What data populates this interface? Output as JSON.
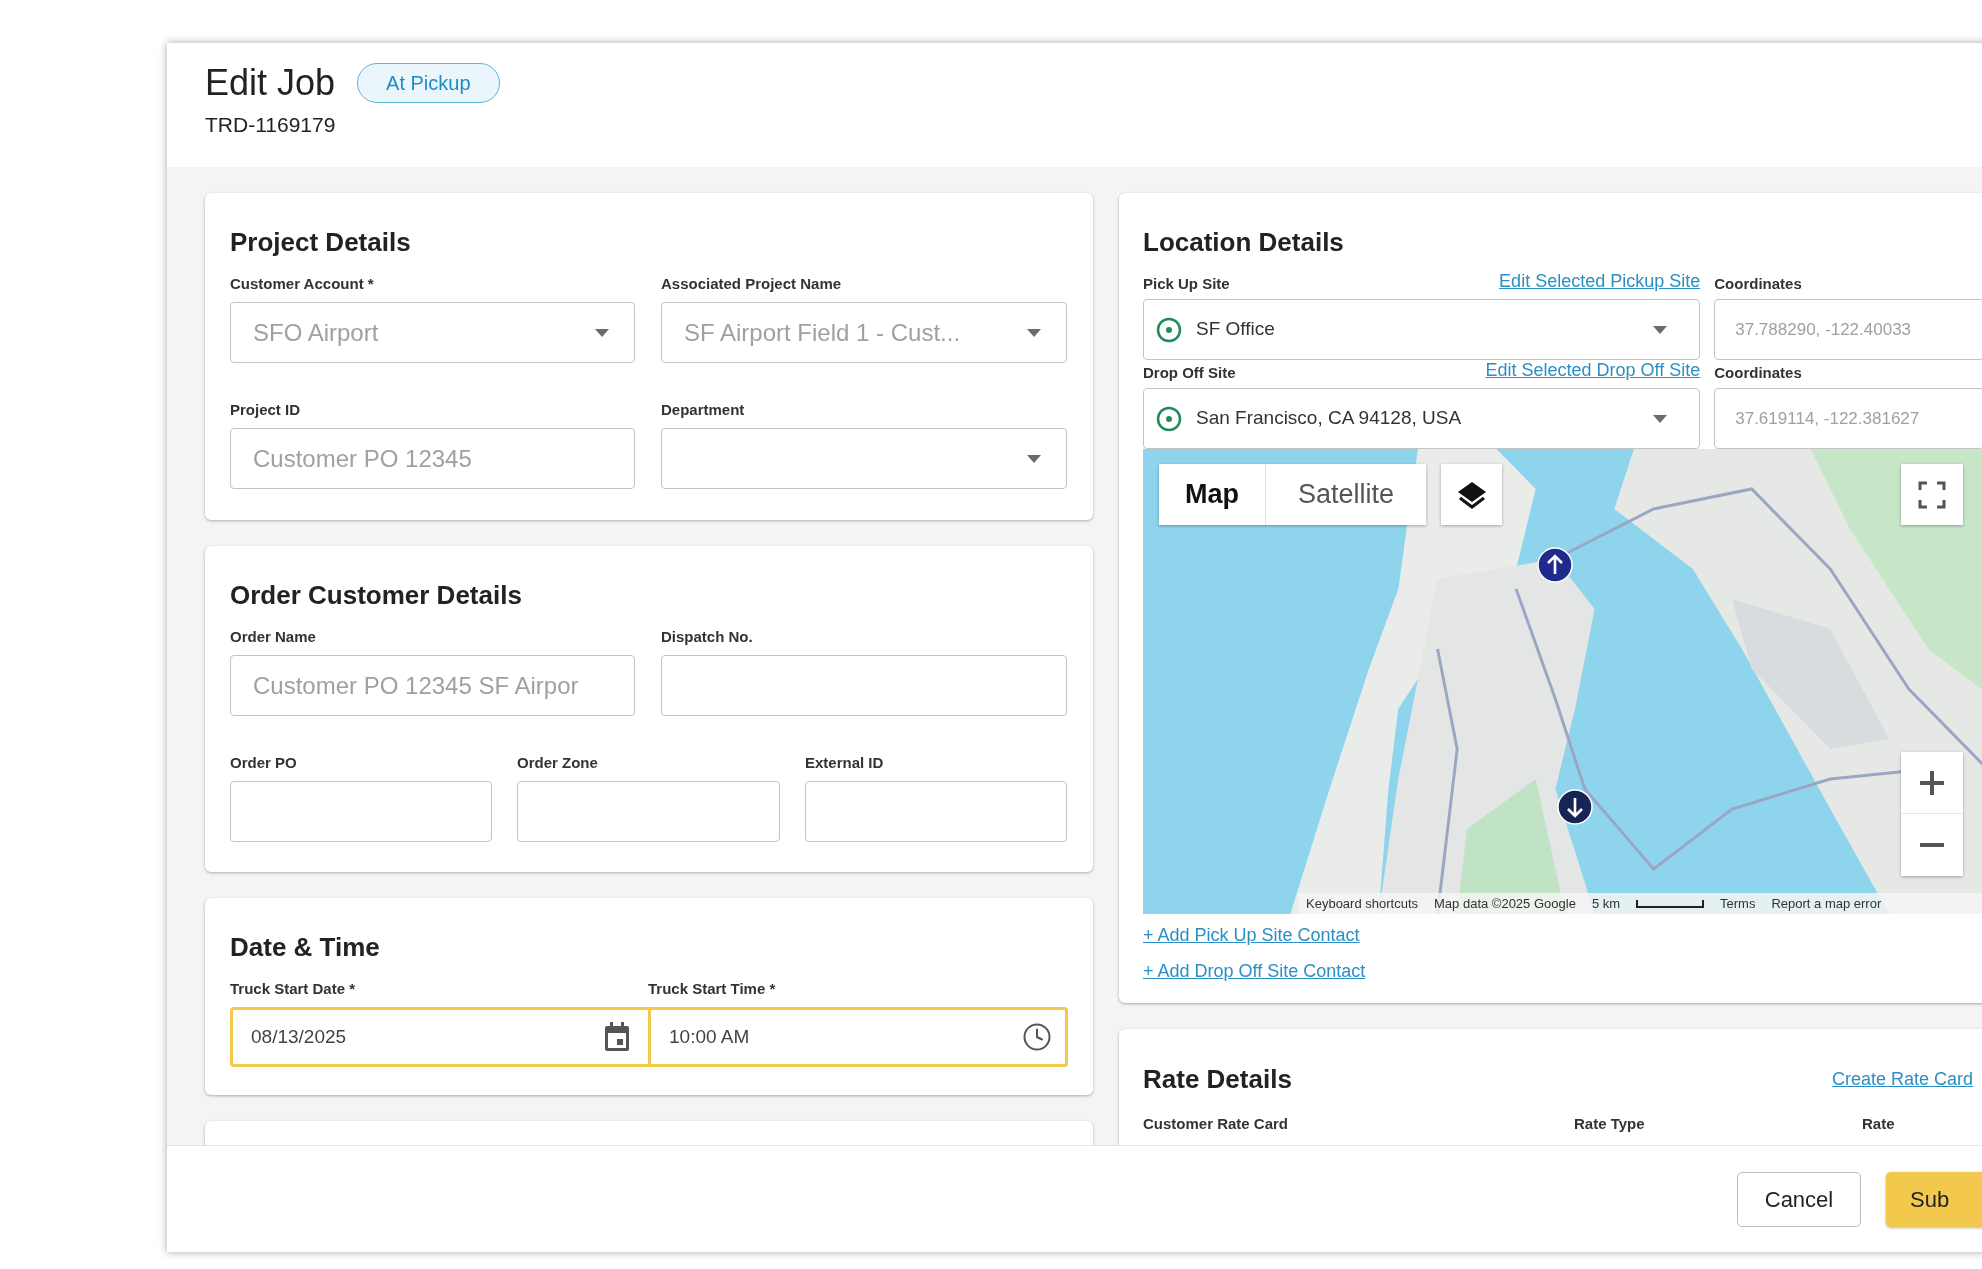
{
  "header": {
    "title": "Edit Job",
    "status": "At Pickup",
    "job_id": "TRD-1169179"
  },
  "project_details": {
    "title": "Project Details",
    "fields": [
      {
        "label": "Customer Account *",
        "placeholder": "SFO Airport",
        "kind": "select"
      },
      {
        "label": "Associated Project Name",
        "placeholder": "SF Airport Field 1 - Cust...",
        "kind": "select"
      },
      {
        "label": "Project ID",
        "placeholder": "Customer PO 12345",
        "kind": "text"
      },
      {
        "label": "Department",
        "kind": "select"
      }
    ]
  },
  "order_customer_details": {
    "title": "Order Customer Details",
    "fields": [
      {
        "label": "Order Name",
        "placeholder": "Customer PO 12345 SF Airpor"
      },
      {
        "label": "Dispatch No."
      }
    ],
    "fields_row_2": [
      {
        "label": "Order PO"
      },
      {
        "label": "Order Zone"
      },
      {
        "label": "External ID"
      }
    ]
  },
  "date_time": {
    "title": "Date & Time",
    "focused": true,
    "fields": [
      {
        "label": "Truck Start Date *",
        "value": "08/13/2025",
        "kind": "date"
      },
      {
        "label": "Truck Start Time *",
        "value": "10:00 AM",
        "kind": "time"
      }
    ]
  },
  "location_details": {
    "title": "Location Details",
    "sites": [
      {
        "label": "Pick Up Site",
        "link": "Edit Selected Pickup Site",
        "value": "SF Office",
        "coordinates_label": "Coordinates",
        "coordinates": "37.788290, -122.40033"
      },
      {
        "label": "Drop Off Site",
        "link": "Edit Selected Drop Off Site",
        "value": "San Francisco, CA 94128, USA",
        "coordinates_label": "Coordinates",
        "coordinates": "37.619114, -122.381627"
      }
    ],
    "map": {
      "tabs": [
        {
          "label": "Map",
          "selected": true
        },
        {
          "label": "Satellite",
          "selected": false
        }
      ],
      "attribution": [
        "Keyboard shortcuts",
        "Map data ©2025 Google"
      ],
      "scale": "5 km",
      "links": [
        "Terms",
        "Report a map error"
      ]
    },
    "links": [
      "+ Add Pick Up Site Contact",
      "+ Add Drop Off Site Contact"
    ]
  },
  "rate_details": {
    "title": "Rate Details",
    "link": "Create Rate Card",
    "columns": [
      "Customer Rate Card",
      "Rate Type",
      "Rate"
    ]
  },
  "footer": {
    "buttons": [
      {
        "label": "Cancel",
        "kind": "secondary"
      },
      {
        "label": "Sub",
        "kind": "primary"
      }
    ]
  }
}
